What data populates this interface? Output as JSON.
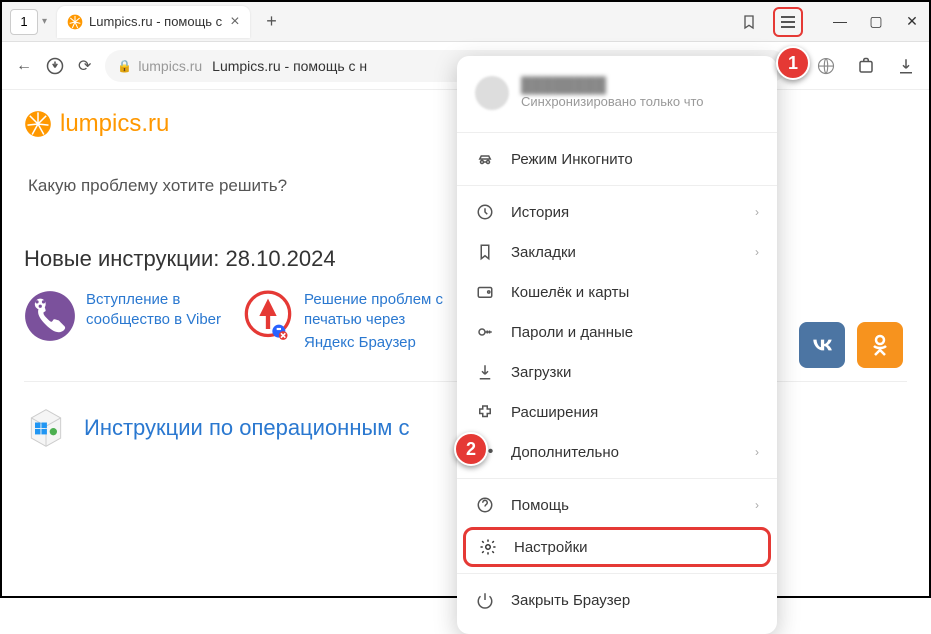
{
  "tab": {
    "number": "1",
    "title": "Lumpics.ru - помощь с"
  },
  "url": {
    "domain": "lumpics.ru",
    "rest": "Lumpics.ru - помощь с н"
  },
  "logo": "lumpics.ru",
  "searchPrompt": "Какую проблему хотите решить?",
  "newSection": "Новые инструкции: 28.10.2024",
  "card1": {
    "link": "Вступление в сообщество в Viber"
  },
  "card2": {
    "link": "Решение проблем с печатью через",
    "sub": "Яндекс Браузер"
  },
  "osSection": "Инструкции по операционным с",
  "user": {
    "name": "████████",
    "sync": "Синхронизировано только что"
  },
  "menu": {
    "incognito": "Режим Инкогнито",
    "history": "История",
    "bookmarks": "Закладки",
    "wallet": "Кошелёк и карты",
    "passwords": "Пароли и данные",
    "downloads": "Загрузки",
    "extensions": "Расширения",
    "more": "Дополнительно",
    "help": "Помощь",
    "settings": "Настройки",
    "close": "Закрыть Браузер"
  },
  "badges": {
    "b1": "1",
    "b2": "2"
  }
}
